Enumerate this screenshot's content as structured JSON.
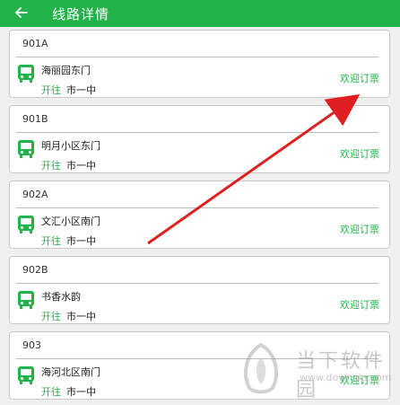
{
  "header": {
    "title": "线路详情",
    "back_icon": "arrow-left-icon"
  },
  "colors": {
    "primary": "#22b24a",
    "accent_arrow": "#e02020"
  },
  "routes": [
    {
      "number": "901A",
      "stop": "海丽园东门",
      "direction_label": "开往",
      "destination": "市一中",
      "action": "欢迎订票"
    },
    {
      "number": "901B",
      "stop": "明月小区东门",
      "direction_label": "开往",
      "destination": "市一中",
      "action": "欢迎订票"
    },
    {
      "number": "902A",
      "stop": "文汇小区南门",
      "direction_label": "开往",
      "destination": "市一中",
      "action": "欢迎订票"
    },
    {
      "number": "902B",
      "stop": "书香水韵",
      "direction_label": "开往",
      "destination": "市一中",
      "action": "欢迎订票"
    },
    {
      "number": "903",
      "stop": "海河北区南门",
      "direction_label": "开往",
      "destination": "市一中",
      "action": "欢迎订票"
    }
  ],
  "watermark": {
    "name": "当下软件园",
    "url": "www.downxia.com"
  }
}
